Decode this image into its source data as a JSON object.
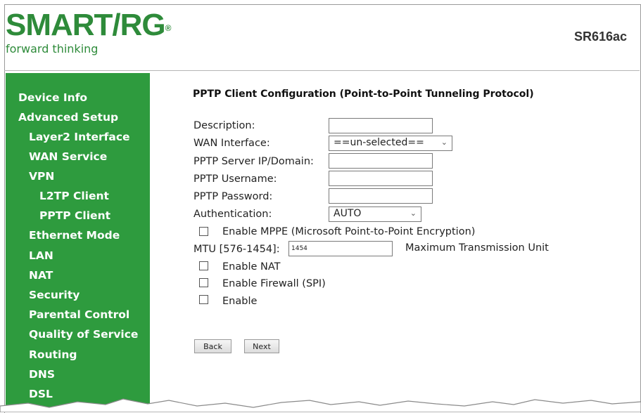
{
  "header": {
    "logo_text": "SMART/RG",
    "logo_reg": "®",
    "tagline": "forward thinking",
    "model": "SR616ac"
  },
  "sidebar": {
    "items": [
      {
        "label": "Device Info"
      },
      {
        "label": "Advanced Setup"
      },
      {
        "label": "Layer2 Interface"
      },
      {
        "label": "WAN Service"
      },
      {
        "label": "VPN"
      },
      {
        "label": "L2TP Client"
      },
      {
        "label": "PPTP Client"
      },
      {
        "label": "Ethernet Mode"
      },
      {
        "label": "LAN"
      },
      {
        "label": "NAT"
      },
      {
        "label": "Security"
      },
      {
        "label": "Parental Control"
      },
      {
        "label": "Quality of Service"
      },
      {
        "label": "Routing"
      },
      {
        "label": "DNS"
      },
      {
        "label": "DSL"
      }
    ]
  },
  "form": {
    "title": "PPTP Client Configuration (Point-to-Point Tunneling Protocol)",
    "description_label": "Description:",
    "description_value": "",
    "wan_interface_label": "WAN Interface:",
    "wan_interface_value": "==un-selected==",
    "server_label": "PPTP Server IP/Domain:",
    "server_value": "",
    "username_label": "PPTP Username:",
    "username_value": "",
    "password_label": "PPTP Password:",
    "password_value": "",
    "auth_label": "Authentication:",
    "auth_value": "AUTO",
    "mppe_label": "Enable MPPE (Microsoft Point-to-Point Encryption)",
    "mtu_label": "MTU [576-1454]:",
    "mtu_value": "1454",
    "mtu_hint": "Maximum Transmission Unit",
    "nat_label": "Enable NAT",
    "firewall_label": "Enable Firewall (SPI)",
    "enable_label": "Enable",
    "back_label": "Back",
    "next_label": "Next"
  },
  "colors": {
    "brand_green": "#2e8b3a",
    "sidebar_green": "#2e9b3e"
  }
}
